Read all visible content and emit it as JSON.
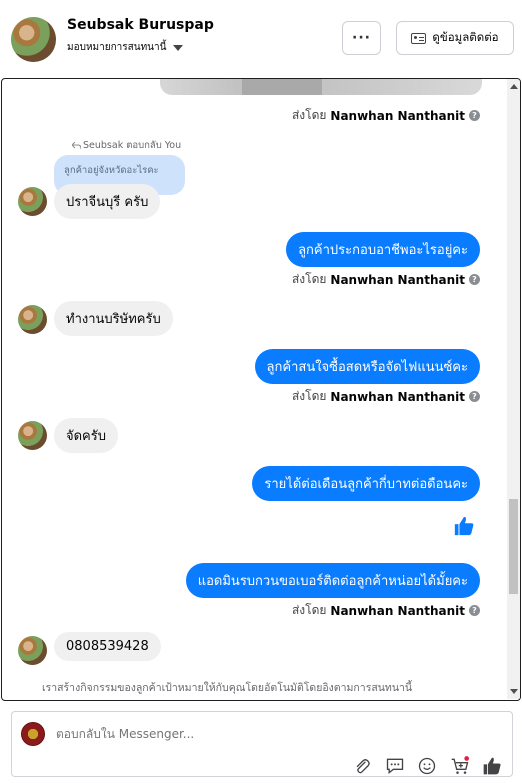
{
  "header": {
    "contact_name": "Seubsak Buruspap",
    "assign_label": "มอบหมายการสนทนานี้",
    "more_label": "···",
    "contact_info_label": "ดูข้อมูลติดต่อ"
  },
  "chat": {
    "sent_by_prefix": "ส่งโดย",
    "agent_name": "Nanwhan Nanthanit",
    "reply_label": "Seubsak ตอบกลับ You",
    "reply_quote": "ลูกค้าอยู่จังหวัดอะไรคะ",
    "messages": [
      {
        "dir": "in",
        "text": "ปราจีนบุรี ครับ"
      },
      {
        "dir": "out",
        "text": "ลูกค้าประกอบอาชีพอะไรอยู่คะ"
      },
      {
        "dir": "in",
        "text": "ทำงานบริษัทครับ"
      },
      {
        "dir": "out",
        "text": "ลูกค้าสนใจซื้อสดหรือจัดไฟแนนซ์คะ"
      },
      {
        "dir": "in",
        "text": "จัดครับ"
      },
      {
        "dir": "out",
        "text": "รายได้ต่อเดือนลูกค้ากี่บาทต่อดือนคะ"
      },
      {
        "dir": "out",
        "text": "แอดมินรบกวนขอเบอร์ติดต่อลูกค้าหน่อยได้มั้ยคะ"
      },
      {
        "dir": "in",
        "text": "0808539428"
      }
    ],
    "system_note": "เราสร้างกิจกรรมของลูกค้าเป้าหมายให้กับคุณโดยอัตโนมัติโดยอิงตามการสนทนานี้"
  },
  "composer": {
    "placeholder": "ตอบกลับใน Messenger..."
  },
  "icons": [
    "attach-icon",
    "comment-icon",
    "emoji-icon",
    "cart-icon",
    "like-icon",
    "info-icon",
    "contact-card-icon",
    "reply-arrow-icon"
  ],
  "colors": {
    "accent": "#0a7cff",
    "incoming": "#f0f0f0",
    "quote": "#cfe2fb"
  }
}
